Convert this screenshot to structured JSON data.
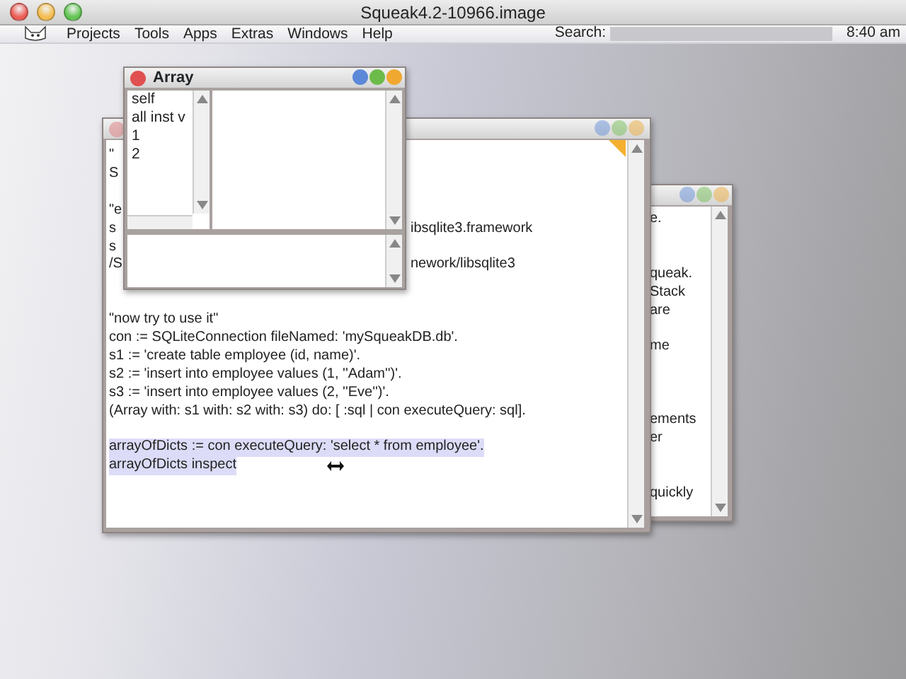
{
  "window": {
    "title": "Squeak4.2-10966.image"
  },
  "menu_bar": {
    "items": [
      "Projects",
      "Tools",
      "Apps",
      "Extras",
      "Windows",
      "Help"
    ],
    "search_label": "Search:",
    "clock": "8:40 am"
  },
  "back_window": {
    "lines": [
      "e.",
      "queak.",
      "Stack",
      "are",
      "me",
      "ements",
      "er",
      "quickly"
    ]
  },
  "workspace": {
    "lines": [
      {
        "left": "\"",
        "selected": false
      },
      {
        "left": "S",
        "selected": false
      },
      {
        "left": "\"e",
        "selected": false
      },
      {
        "left": "s",
        "right": "ibsqlite3.framework",
        "selected": false
      },
      {
        "left": "s",
        "selected": false
      },
      {
        "left": "/S",
        "right": "nework/libsqlite3",
        "selected": false
      },
      {
        "left": "\"now try to use it\"",
        "selected": false
      },
      {
        "left": "con := SQLiteConnection fileNamed: 'mySqueakDB.db'.",
        "selected": false
      },
      {
        "left": "s1 := 'create table employee (id, name)'.",
        "selected": false
      },
      {
        "left": "s2 := 'insert into employee values (1, ''Adam'')'.",
        "selected": false
      },
      {
        "left": "s3 := 'insert into employee values (2, ''Eve'')'.",
        "selected": false
      },
      {
        "left": "(Array with: s1 with: s2 with: s3) do: [ :sql | con executeQuery: sql].",
        "selected": false
      },
      {
        "left": "arrayOfDicts := con executeQuery: 'select * from employee'.",
        "selected": true
      },
      {
        "left": "arrayOfDicts inspect",
        "selected": true
      }
    ]
  },
  "inspector": {
    "title": "Array",
    "fields": [
      {
        "label": "self",
        "selected": false
      },
      {
        "label": "all inst v",
        "selected": false
      },
      {
        "label": "1",
        "selected": false
      },
      {
        "label": "2",
        "selected": false
      }
    ]
  }
}
